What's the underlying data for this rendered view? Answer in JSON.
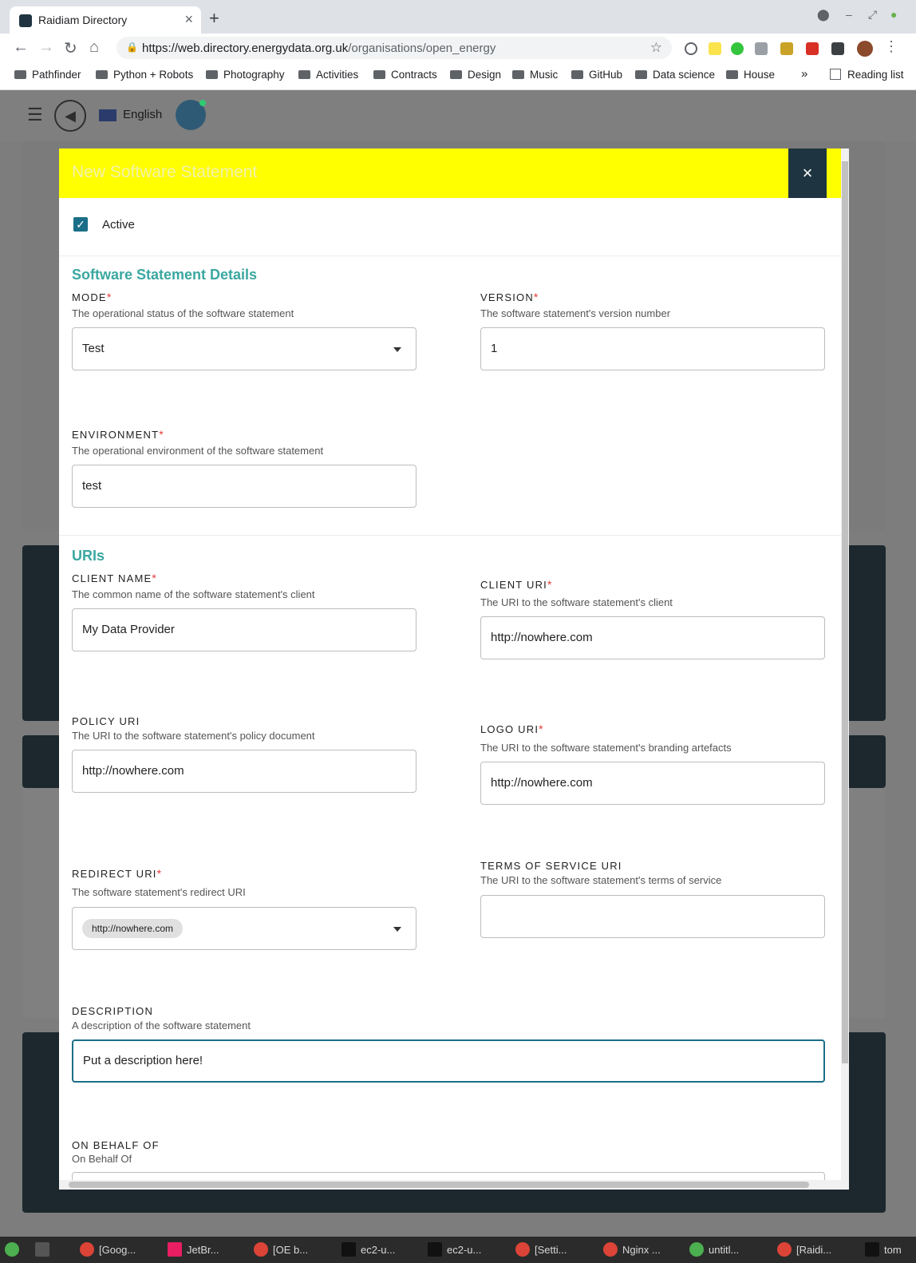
{
  "browser": {
    "tab_title": "Raidiam Directory",
    "tab_close": "×",
    "new_tab": "+",
    "url_host": "https://web.directory.energydata.org.uk",
    "url_path": "/organisations/open_energy",
    "bookmarks": [
      "Pathfinder",
      "Python + Robots",
      "Photography",
      "Activities",
      "Contracts",
      "Design",
      "Music",
      "GitHub",
      "Data science",
      "House"
    ],
    "bookmarks_overflow": "»",
    "reading_list": "Reading list"
  },
  "appbar": {
    "language": "English"
  },
  "modal": {
    "title": "New Software Statement",
    "close": "×",
    "active_label": "Active",
    "active_checked": true,
    "details_title": "Software Statement Details",
    "uris_title": "URIs",
    "fields": {
      "mode": {
        "label": "MODE",
        "help": "The operational status of the software statement",
        "value": "Test"
      },
      "version": {
        "label": "VERSION",
        "help": "The software statement's version number",
        "value": "1"
      },
      "environment": {
        "label": "ENVIRONMENT",
        "help": "The operational environment of the software statement",
        "value": "test"
      },
      "client_name": {
        "label": "CLIENT NAME",
        "help": "The common name of the software statement's client",
        "value": "My Data Provider"
      },
      "client_uri": {
        "label": "CLIENT URI",
        "help": "The URI to the software statement's client",
        "value": "http://nowhere.com"
      },
      "policy_uri": {
        "label": "POLICY URI",
        "help": "The URI to the software statement's policy document",
        "value": "http://nowhere.com"
      },
      "logo_uri": {
        "label": "LOGO URI",
        "help": "The URI to the software statement's branding artefacts",
        "value": "http://nowhere.com"
      },
      "redirect_uri": {
        "label": "REDIRECT URI",
        "help": "The software statement's redirect URI",
        "chip": "http://nowhere.com"
      },
      "tos_uri": {
        "label": "TERMS OF SERVICE URI",
        "help": "The URI to the software statement's terms of service",
        "value": ""
      },
      "description": {
        "label": "DESCRIPTION",
        "help": "A description of the software statement",
        "value": "Put a description here!"
      },
      "on_behalf_of": {
        "label": "ON BEHALF OF",
        "help": "On Behalf Of"
      }
    },
    "required_mark": "*"
  },
  "taskbar": {
    "items": [
      "[Goog...",
      "JetBr...",
      "[OE b...",
      "ec2-u...",
      "ec2-u...",
      "[Setti...",
      "Nginx ...",
      "untitl...",
      "[Raidi...",
      "tom"
    ]
  },
  "colors": {
    "accent_yellow": "#ffff00",
    "teal": "#3aa7a0",
    "dark_navy": "#1e3440",
    "required_red": "#e53935"
  }
}
